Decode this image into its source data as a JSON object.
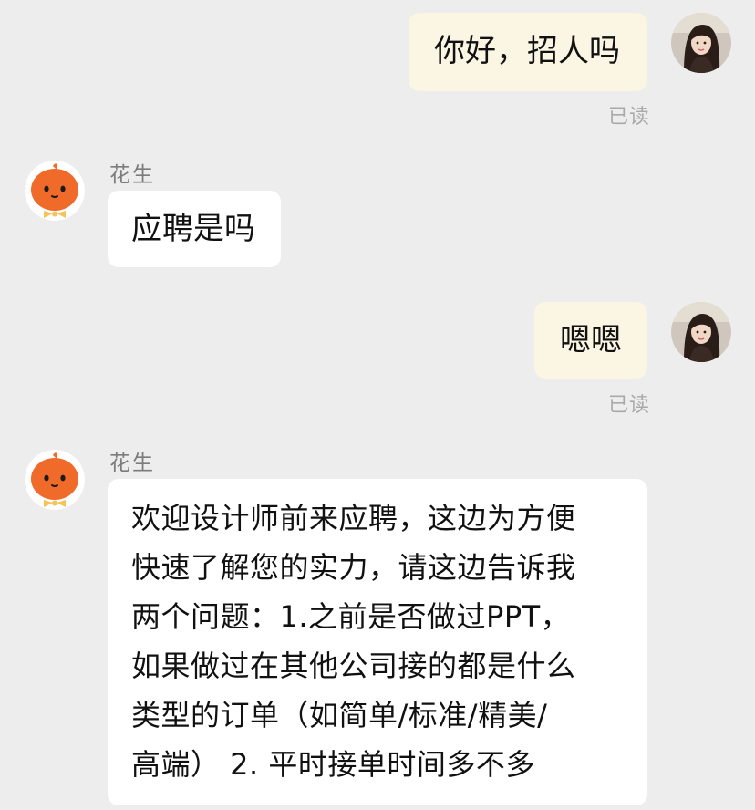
{
  "messages": [
    {
      "sender": "me",
      "text": "你好，招人吗",
      "status": "已读"
    },
    {
      "sender": "花生",
      "text": "应聘是吗"
    },
    {
      "sender": "me",
      "text": "嗯嗯",
      "status": "已读"
    },
    {
      "sender": "花生",
      "lines": [
        "欢迎设计师前来应聘，这边为方便",
        "快速了解您的实力，请这边告诉我",
        "两个问题：1.之前是否做过PPT，",
        "如果做过在其他公司接的都是什么",
        "类型的订单（如简单/标准/精美/",
        "高端） 2. 平时接单时间多不多"
      ]
    }
  ],
  "icons": {
    "me_avatar": "user-photo-avatar",
    "bot_avatar": "orange-pumpkin-mascot-icon"
  },
  "colors": {
    "background": "#ededed",
    "my_bubble": "#fbf5e3",
    "their_bubble": "#ffffff",
    "mascot": "#f06a2a"
  }
}
